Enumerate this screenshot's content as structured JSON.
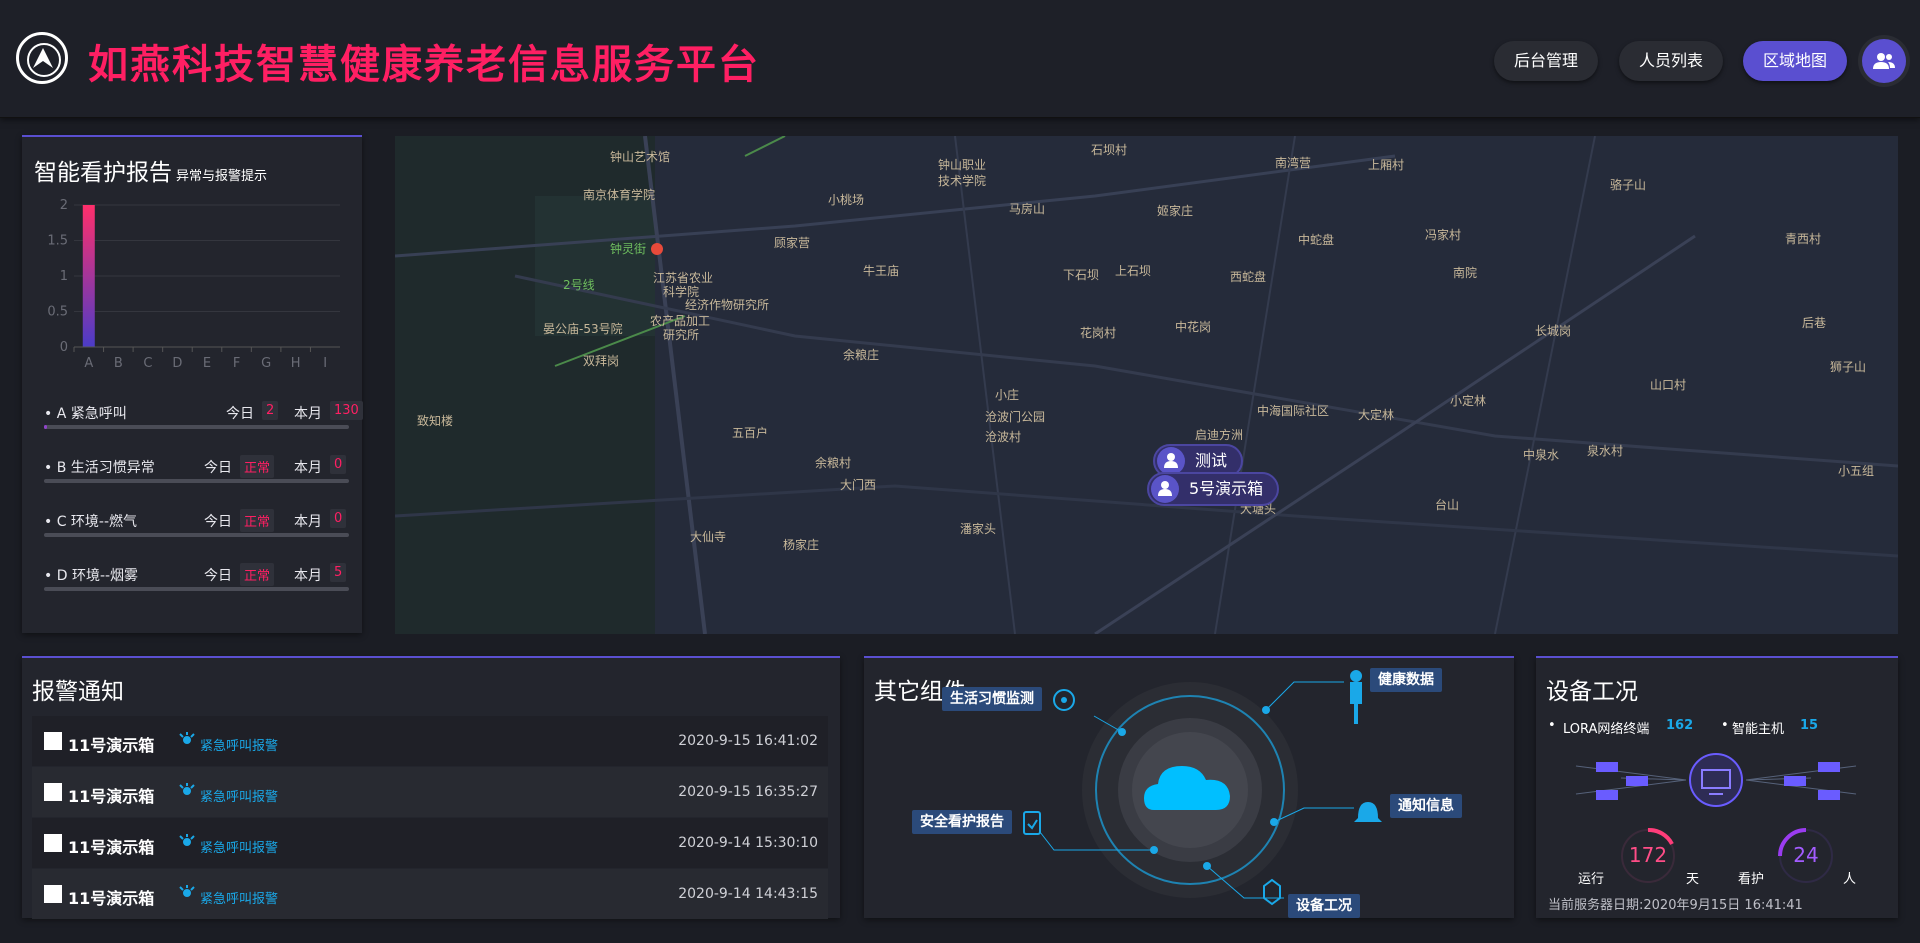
{
  "header": {
    "title": "如燕科技智慧健康养老信息服务平台",
    "nav": [
      "后台管理",
      "人员列表",
      "区域地图"
    ],
    "active_nav": "区域地图",
    "accent": "#5a4fd0",
    "title_color": "#ff1f63"
  },
  "report": {
    "title": "智能看护报告",
    "subtitle": "异常与报警提示",
    "chart_data": {
      "type": "bar",
      "categories": [
        "A",
        "B",
        "C",
        "D",
        "E",
        "F",
        "G",
        "H",
        "I"
      ],
      "values": [
        2,
        0,
        0,
        0,
        0,
        0,
        0,
        0,
        0
      ],
      "yticks": [
        "0",
        "0.5",
        "1",
        "1.5",
        "2"
      ],
      "ylim": [
        0,
        2
      ],
      "grid": true
    },
    "items": [
      {
        "name": "• A 紧急呼叫",
        "today_label": "今日",
        "today": "2",
        "month_label": "本月",
        "month": "130",
        "fill": 0.01
      },
      {
        "name": "• B 生活习惯异常",
        "today_label": "今日",
        "today": "正常",
        "month_label": "本月",
        "month": "0",
        "fill": 0
      },
      {
        "name": "• C 环境--燃气",
        "today_label": "今日",
        "today": "正常",
        "month_label": "本月",
        "month": "0",
        "fill": 0
      },
      {
        "name": "• D 环境--烟雾",
        "today_label": "今日",
        "today": "正常",
        "month_label": "本月",
        "month": "5",
        "fill": 0
      }
    ]
  },
  "map": {
    "labels": [
      {
        "text": "钟山艺术馆"
      },
      {
        "text": "南京体育学院"
      },
      {
        "text": "钟山职业"
      },
      {
        "text": "技术学院"
      },
      {
        "text": "石坝村"
      },
      {
        "text": "南湾营"
      },
      {
        "text": "上厢村"
      },
      {
        "text": "骆子山"
      },
      {
        "text": "小桃场"
      },
      {
        "text": "马房山"
      },
      {
        "text": "姬家庄"
      },
      {
        "text": "钟灵街"
      },
      {
        "text": "顾家营"
      },
      {
        "text": "中蛇盘"
      },
      {
        "text": "冯家村"
      },
      {
        "text": "青西村"
      },
      {
        "text": "江苏省农业"
      },
      {
        "text": "科学院"
      },
      {
        "text": "牛王庙"
      },
      {
        "text": "下石坝"
      },
      {
        "text": "上石坝"
      },
      {
        "text": "西蛇盘"
      },
      {
        "text": "南院"
      },
      {
        "text": "2号线"
      },
      {
        "text": "经济作物研究所"
      },
      {
        "text": "农产品加工"
      },
      {
        "text": "研究所"
      },
      {
        "text": "晏公庙-53号院"
      },
      {
        "text": "花岗村"
      },
      {
        "text": "中花岗"
      },
      {
        "text": "后巷"
      },
      {
        "text": "长城岗"
      },
      {
        "text": "双拜岗"
      },
      {
        "text": "余粮庄"
      },
      {
        "text": "狮子山"
      },
      {
        "text": "山口村"
      },
      {
        "text": "小庄"
      },
      {
        "text": "沧波门公园"
      },
      {
        "text": "中海国际社区"
      },
      {
        "text": "大定林"
      },
      {
        "text": "小定林"
      },
      {
        "text": "致知楼"
      },
      {
        "text": "五百户"
      },
      {
        "text": "沧波村"
      },
      {
        "text": "启迪方洲"
      },
      {
        "text": "余粮村"
      },
      {
        "text": "中泉水"
      },
      {
        "text": "泉水村"
      },
      {
        "text": "小五组"
      },
      {
        "text": "大门西"
      },
      {
        "text": "台山"
      },
      {
        "text": "潘家头"
      },
      {
        "text": "大仙寺"
      },
      {
        "text": "杨家庄"
      },
      {
        "text": "大塘头"
      }
    ],
    "markers": [
      "测试",
      "5号演示箱"
    ]
  },
  "alarms": {
    "title": "报警通知",
    "rows": [
      {
        "device": "11号演示箱",
        "type": "紧急呼叫报警",
        "time": "2020-9-15 16:41:02"
      },
      {
        "device": "11号演示箱",
        "type": "紧急呼叫报警",
        "time": "2020-9-15 16:35:27"
      },
      {
        "device": "11号演示箱",
        "type": "紧急呼叫报警",
        "time": "2020-9-14 15:30:10"
      },
      {
        "device": "11号演示箱",
        "type": "紧急呼叫报警",
        "time": "2020-9-14 14:43:15"
      }
    ]
  },
  "components": {
    "title": "其它组件",
    "items": [
      "生活习惯监测",
      "健康数据",
      "通知信息",
      "安全看护报告",
      "设备工况"
    ]
  },
  "device": {
    "title": "设备工况",
    "lora_label": "LORA网络终端",
    "lora_count": "162",
    "host_label": "智能主机",
    "host_count": "15",
    "run_label": "运行",
    "run_value": "172",
    "run_unit": "天",
    "care_label": "看护",
    "care_value": "24",
    "care_unit": "人",
    "server_date_label": "当前服务器日期:",
    "server_date": "2020年9月15日 16:41:41"
  }
}
